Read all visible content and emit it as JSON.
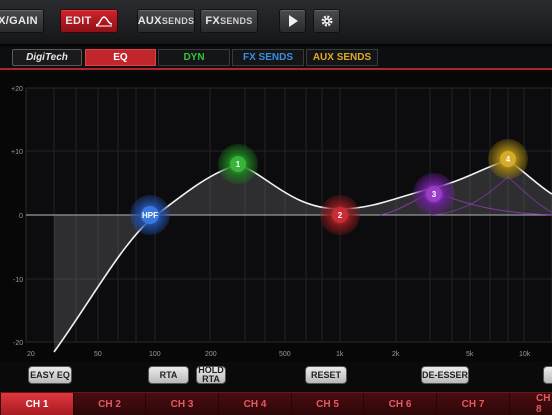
{
  "topbar": {
    "buttons": [
      {
        "label": "X/GAIN"
      },
      {
        "label": "EDIT"
      },
      {
        "label_a": "AUX",
        "label_b": "SENDS"
      },
      {
        "label_a": "FX",
        "label_b": "SENDS"
      }
    ]
  },
  "brand": {
    "logo": "DigiTech"
  },
  "tabs": [
    {
      "label": "EQ",
      "color": "#ffffff"
    },
    {
      "label": "DYN",
      "color": "#35c33b"
    },
    {
      "label": "FX SENDS",
      "color": "#3a8ee0"
    },
    {
      "label": "AUX SENDS",
      "color": "#e0a82a"
    }
  ],
  "graph": {
    "y_ticks": [
      "+20",
      "+10",
      "0",
      "-10",
      "-20"
    ],
    "x_ticks": [
      "20",
      "50",
      "100",
      "200",
      "500",
      "1k",
      "2k",
      "5k",
      "10k"
    ],
    "nodes": [
      {
        "label": "HPF",
        "color": "#2f6fd0"
      },
      {
        "label": "1",
        "color": "#2ea02e"
      },
      {
        "label": "2",
        "color": "#b4262c"
      },
      {
        "label": "3",
        "color": "#8a2fb8"
      },
      {
        "label": "4",
        "color": "#c9a322"
      }
    ]
  },
  "controls": {
    "easy_eq": "EASY EQ",
    "rta": "RTA",
    "hold_rta_a": "HOLD",
    "hold_rta_b": "RTA",
    "reset": "RESET",
    "de_esser": "DE-ESSER"
  },
  "channels": [
    "CH 1",
    "CH 2",
    "CH 3",
    "CH 4",
    "CH 5",
    "CH 6",
    "CH 7",
    "CH 8"
  ]
}
